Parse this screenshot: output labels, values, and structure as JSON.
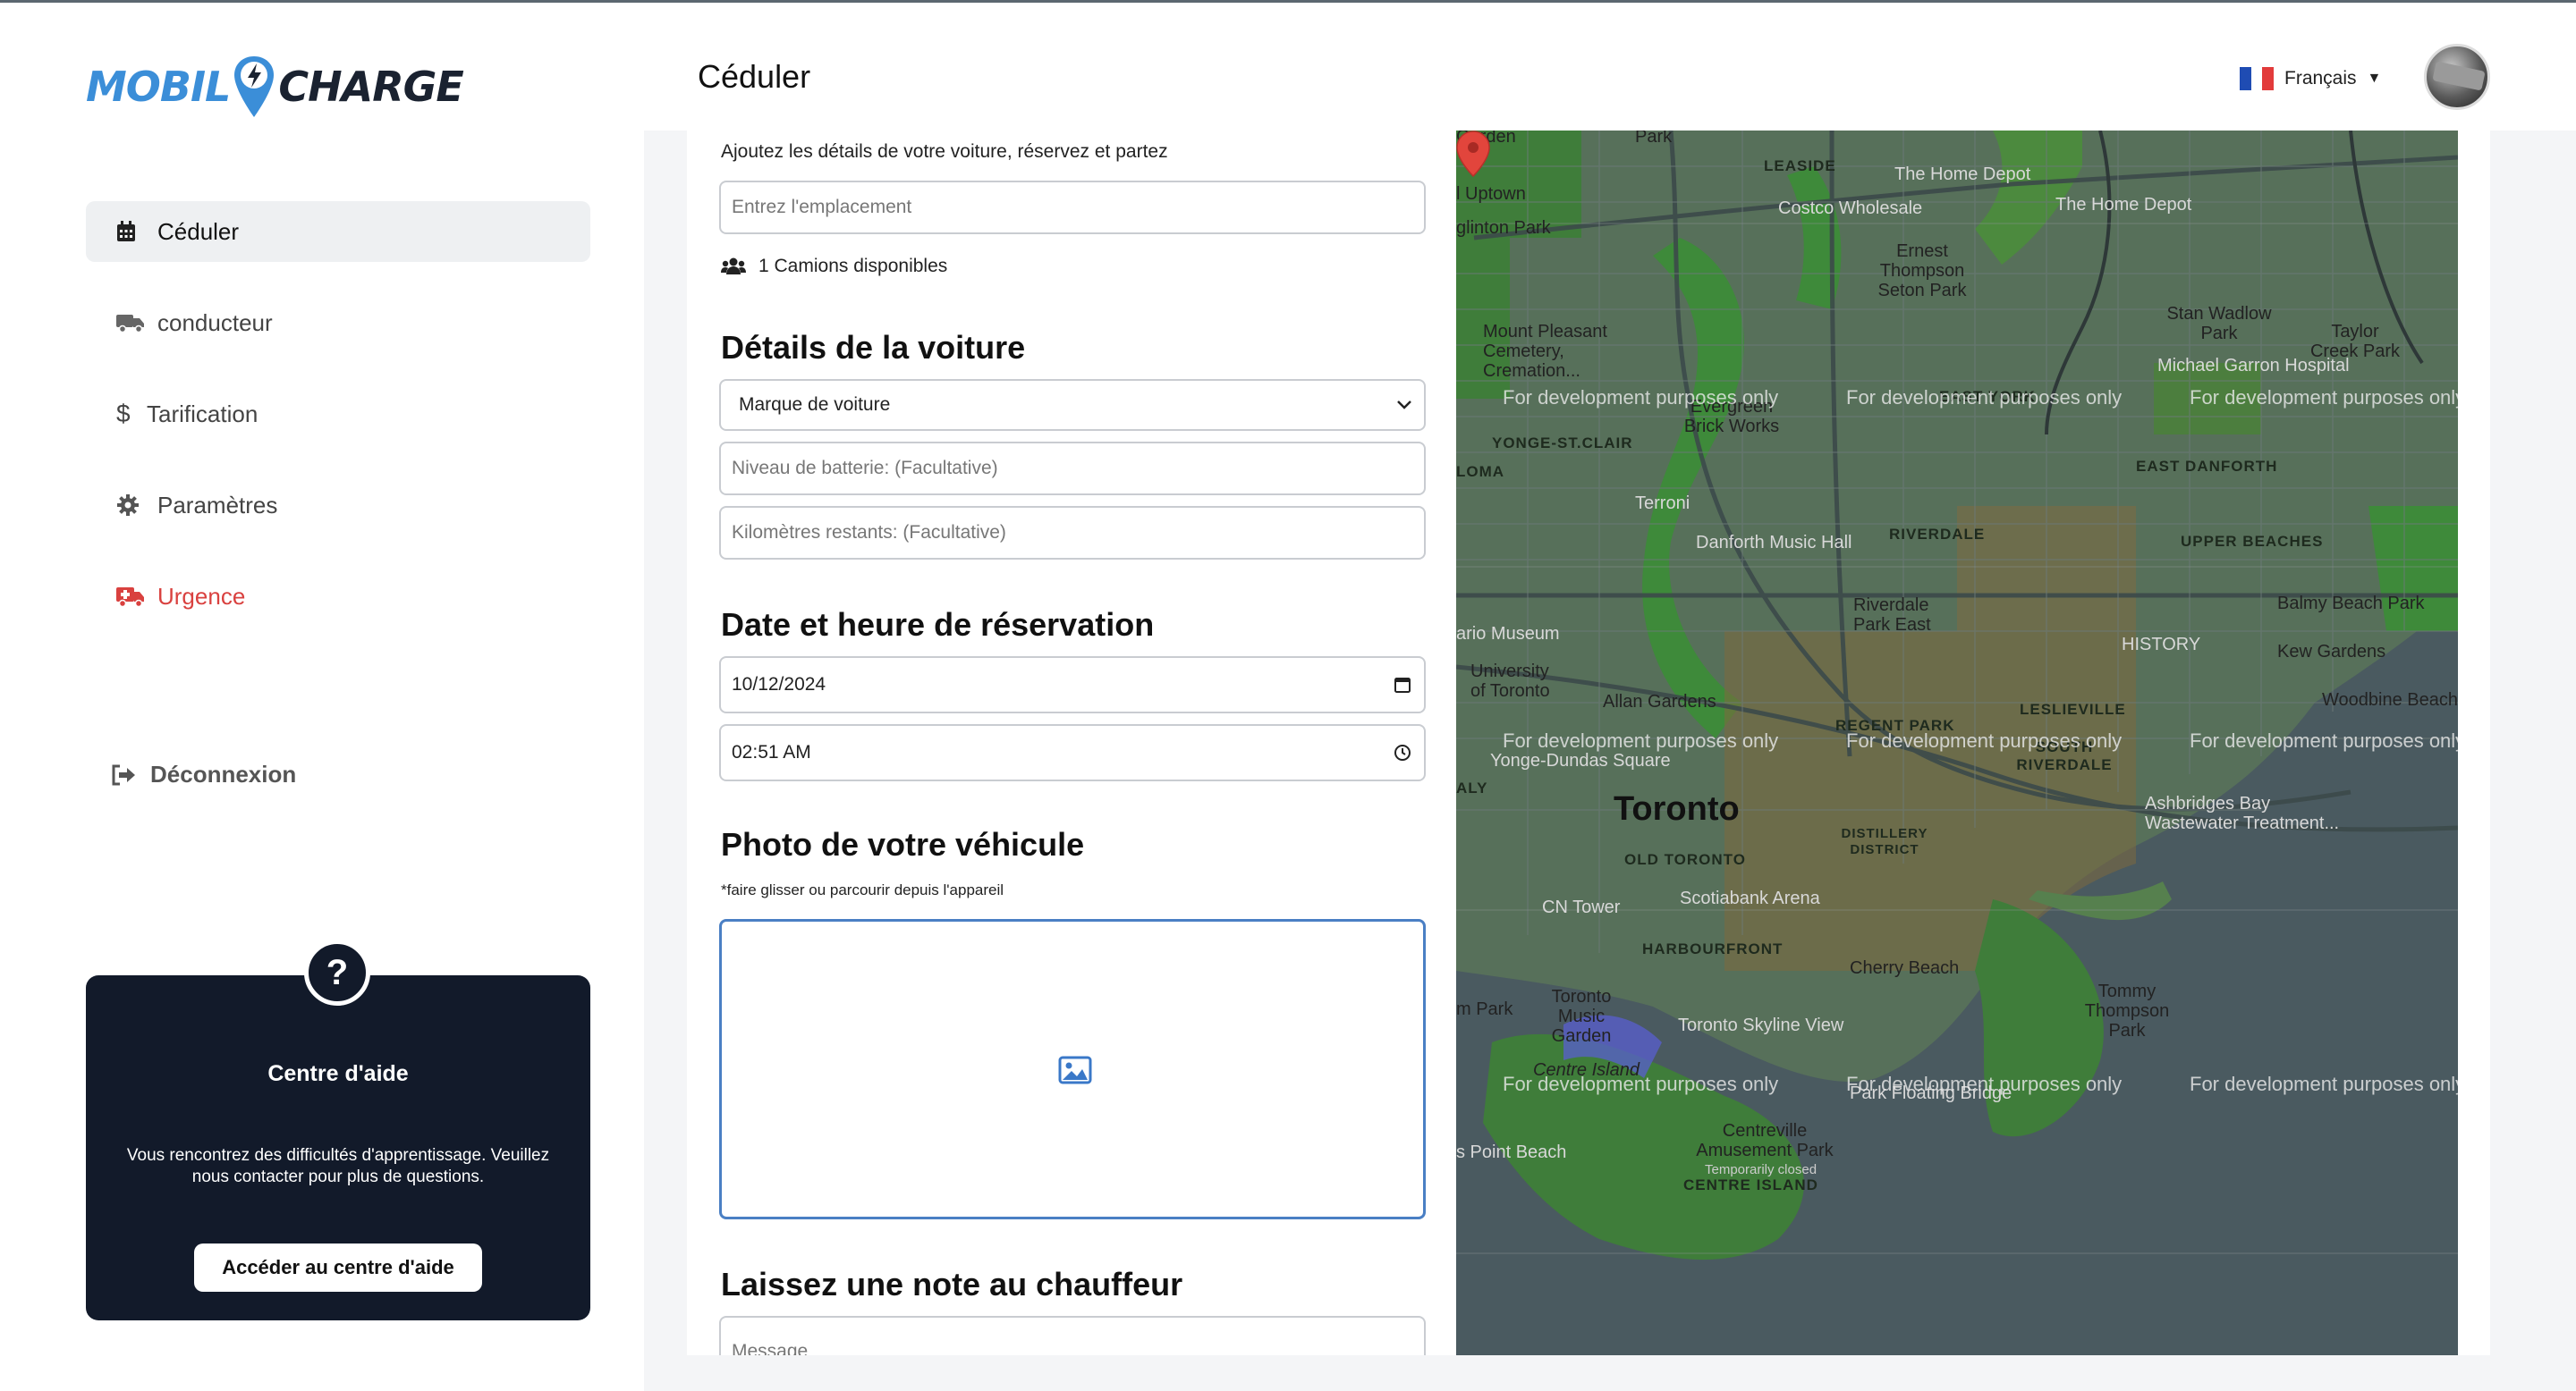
{
  "app": {
    "logo_left": "MOBIL",
    "logo_right": "CHARGE"
  },
  "header": {
    "title": "Céduler",
    "language": "Français"
  },
  "sidebar": {
    "items": [
      {
        "label": "Céduler",
        "icon": "calendar-icon"
      },
      {
        "label": "conducteur",
        "icon": "truck-icon"
      },
      {
        "label": "Tarification",
        "icon": "dollar-icon"
      },
      {
        "label": "Paramètres",
        "icon": "gear-icon"
      },
      {
        "label": "Urgence",
        "icon": "ambulance-icon"
      }
    ],
    "logout": "Déconnexion"
  },
  "help": {
    "icon": "question-icon",
    "title": "Centre d'aide",
    "text": "Vous rencontrez des difficultés d'apprentissage. Veuillez nous contacter pour plus de questions.",
    "button": "Accéder au centre d'aide"
  },
  "form": {
    "subtitle": "Ajoutez les détails de votre voiture, réservez et partez",
    "location_placeholder": "Entrez l'emplacement",
    "trucks_available": "1 Camions disponibles",
    "car_section": "Détails de la voiture",
    "car_brand": "Marque de voiture",
    "battery_placeholder": "Niveau de batterie: (Facultative)",
    "km_placeholder": "Kilomètres restants: (Facultative)",
    "date_section": "Date et heure de réservation",
    "date_value": "10/12/2024",
    "time_value": "02:51 AM",
    "photo_section": "Photo de votre véhicule",
    "photo_hint": "*faire glisser ou parcourir depuis l'appareil",
    "note_section": "Laissez une note au chauffeur",
    "message_placeholder": "Message"
  },
  "map": {
    "city": "Toronto",
    "dev_watermark": "For development purposes only",
    "labels": {
      "leaside": "LEASIDE",
      "home_depot_1": "The Home Depot",
      "home_depot_2": "The Home Depot",
      "costco": "Costco Wholesale",
      "uptown": "l Uptown",
      "eglinton": "glinton Park",
      "mount_pleasant": "Mount Pleasant Cemetery, Cremation...",
      "ernest": "Ernest Thompson Seton Park",
      "stan_wadlow": "Stan Wadlow Park",
      "taylor_creek": "Taylor Creek Park",
      "michael_garron": "Michael Garron Hospital",
      "evergreen": "Evergreen Brick Works",
      "east_york": "EAST YORK",
      "yonge_st_clair": "YONGE-ST.CLAIR",
      "east_danforth": "EAST DANFORTH",
      "terroni": "Terroni",
      "danforth_music": "Danforth Music Hall",
      "riverdale": "RIVERDALE",
      "upper_beaches": "UPPER BEACHES",
      "riverdale_park": "Riverdale Park East",
      "balmy_beach": "Balmy Beach Park",
      "rom": "ario Museum",
      "history": "HISTORY",
      "kew_gardens": "Kew Gardens",
      "uoft": "University of Toronto",
      "allan_gardens": "Allan Gardens",
      "regent_park": "REGENT PARK",
      "leslieville": "LESLIEVILLE",
      "woodbine": "Woodbine Beach",
      "yonge_dundas": "Yonge-Dundas Square",
      "south_riverdale": "SOUTH RIVERDALE",
      "distillery": "DISTILLERY DISTRICT",
      "ashbridges": "Ashbridges Bay Wastewater Treatment...",
      "old_toronto": "OLD TORONTO",
      "cn_tower": "CN Tower",
      "scotiabank": "Scotiabank Arena",
      "harbourfront": "HARBOURFRONT",
      "cherry_beach": "Cherry Beach",
      "music_garden": "Toronto Music Garden",
      "skyline": "Toronto Skyline View",
      "tommy_thompson": "Tommy Thompson Park",
      "centre_island": "Centre Island",
      "floating_bridge": "Park Floating Bridge",
      "centreville": "Centreville Amusement Park",
      "temp_closed": "Temporarily closed",
      "point_beach": "s Point Beach",
      "centre_island_caps": "CENTRE ISLAND",
      "m_park": "m Park"
    }
  }
}
